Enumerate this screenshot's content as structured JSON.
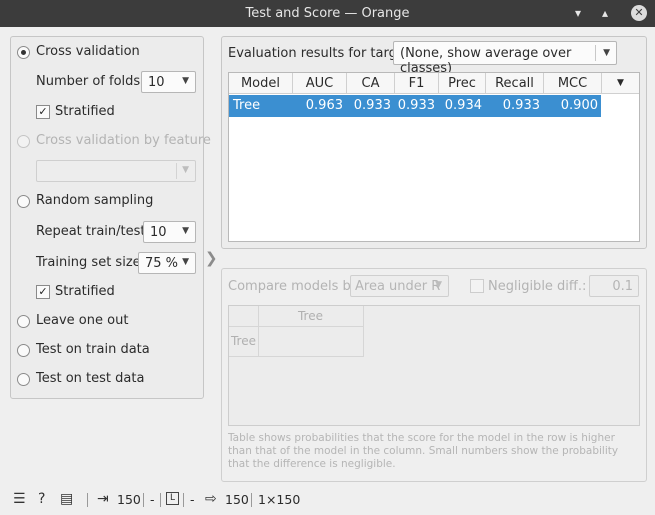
{
  "window": {
    "title": "Test and Score — Orange",
    "btn_min": "▾",
    "btn_max": "▴",
    "btn_close": "✕"
  },
  "left": {
    "cross_validation": {
      "label": "Cross validation",
      "selected": true
    },
    "folds": {
      "label": "Number of folds:",
      "value": "10"
    },
    "stratified1": {
      "label": "Stratified",
      "checked": true
    },
    "cv_by_feature": {
      "label": "Cross validation by feature",
      "enabled": false
    },
    "feature_combo": {
      "value": ""
    },
    "random_sampling": {
      "label": "Random sampling",
      "selected": false
    },
    "repeat": {
      "label": "Repeat train/test:",
      "value": "10"
    },
    "train_size": {
      "label": "Training set size:",
      "value": "75 %"
    },
    "stratified2": {
      "label": "Stratified",
      "checked": true
    },
    "leave_one_out": {
      "label": "Leave one out"
    },
    "train_data": {
      "label": "Test on train data"
    },
    "test_data": {
      "label": "Test on test data"
    }
  },
  "results": {
    "target_label": "Evaluation results for target",
    "target_value": "(None, show average over classes)",
    "columns": [
      "Model",
      "AUC",
      "CA",
      "F1",
      "Prec",
      "Recall",
      "MCC"
    ],
    "rows": [
      {
        "model": "Tree",
        "auc": "0.963",
        "ca": "0.933",
        "f1": "0.933",
        "prec": "0.934",
        "recall": "0.933",
        "mcc": "0.900",
        "selected": true
      }
    ]
  },
  "compare": {
    "label": "Compare models by:",
    "metric_value": "Area under R",
    "negligible_label": "Negligible diff.:",
    "negligible_value": "0.1",
    "grid_col_header": "Tree",
    "grid_row_header": "Tree",
    "note": "Table shows probabilities that the score for the model in the row is higher than that of the model in the column. Small numbers show the probability that the difference is negligible."
  },
  "statusbar": {
    "input_count": "150",
    "dash1": "-",
    "dash2": "-",
    "output_count": "150",
    "shape": "1×150"
  }
}
